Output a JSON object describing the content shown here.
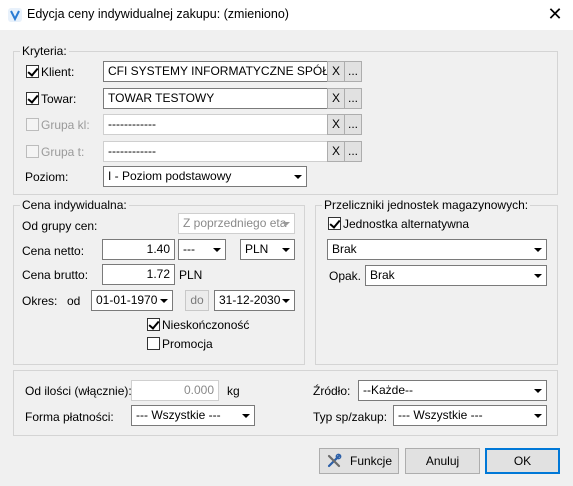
{
  "window": {
    "title": "Edycja ceny indywidualnej zakupu: (zmieniono)",
    "close": "✕"
  },
  "kryteria": {
    "group_label": "Kryteria:",
    "klient": {
      "label": "Klient:",
      "checked": true,
      "value": "CFI SYSTEMY INFORMATYCZNE SPÓŁKA Z",
      "clear": "X",
      "browse": "..."
    },
    "towar": {
      "label": "Towar:",
      "checked": true,
      "value": "TOWAR TESTOWY",
      "clear": "X",
      "browse": "..."
    },
    "grupa_kl": {
      "label": "Grupa kl:",
      "checked": false,
      "value": "------------",
      "clear": "X",
      "browse": "..."
    },
    "grupa_t": {
      "label": "Grupa t:",
      "checked": false,
      "value": "------------",
      "clear": "X",
      "browse": "..."
    },
    "poziom": {
      "label": "Poziom:",
      "value": "I - Poziom podstawowy"
    }
  },
  "cena": {
    "group_label": "Cena indywidualna:",
    "od_grupy_label": "Od grupy cen:",
    "od_grupy_value": "Z poprzedniego eta",
    "netto_label": "Cena netto:",
    "netto_value": "1.40",
    "netto_type": "---",
    "currency": "PLN",
    "brutto_label": "Cena brutto:",
    "brutto_value": "1.72",
    "brutto_currency": "PLN",
    "okres_label": "Okres:",
    "od_label": "od",
    "date_from": "01-01-1970",
    "do_label": "do",
    "date_to": "31-12-2030",
    "nieskonczonosc": {
      "label": "Nieskończoność",
      "checked": true
    },
    "promocja": {
      "label": "Promocja",
      "checked": false
    }
  },
  "przeliczniki": {
    "group_label": "Przeliczniki jednostek magazynowych:",
    "jednostka": {
      "label": "Jednostka alternatywna",
      "checked": true
    },
    "unit_value": "Brak",
    "opak_label": "Opak.",
    "opak_value": "Brak"
  },
  "bottom": {
    "od_ilosci_label": "Od ilości (włącznie):",
    "od_ilosci_value": "0.000",
    "od_ilosci_unit": "kg",
    "forma_label": "Forma płatności:",
    "forma_value": "--- Wszystkie ---",
    "zrodlo_label": "Źródło:",
    "zrodlo_value": "--Każde--",
    "typ_label": "Typ sp/zakup:",
    "typ_value": "--- Wszystkie ---"
  },
  "buttons": {
    "funkcje": "Funkcje",
    "anuluj": "Anuluj",
    "ok": "OK"
  },
  "colors": {
    "accent": "#0078d7",
    "dialog_bg": "#f0f0f0"
  },
  "icons": {
    "app": "v-logo-icon",
    "funkcje": "tools-icon"
  }
}
